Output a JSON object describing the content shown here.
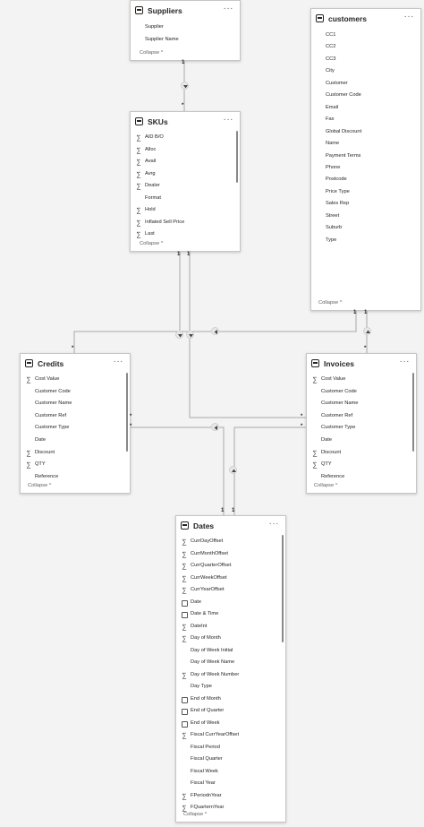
{
  "tables": [
    {
      "id": "suppliers",
      "name": "Suppliers",
      "more": "···",
      "collapse": "Collapse ^",
      "fields": [
        {
          "label": "Supplier",
          "icon": "none"
        },
        {
          "label": "Supplier Name",
          "icon": "none"
        }
      ]
    },
    {
      "id": "customers",
      "name": "customers",
      "more": "···",
      "collapse": "Collapse ^",
      "fields": [
        {
          "label": "CC1",
          "icon": "none"
        },
        {
          "label": "CC2",
          "icon": "none"
        },
        {
          "label": "CC3",
          "icon": "none"
        },
        {
          "label": "City",
          "icon": "none"
        },
        {
          "label": "Customer",
          "icon": "none"
        },
        {
          "label": "Customer Code",
          "icon": "none"
        },
        {
          "label": "Email",
          "icon": "none"
        },
        {
          "label": "Fax",
          "icon": "none"
        },
        {
          "label": "Global Discount",
          "icon": "none"
        },
        {
          "label": "Name",
          "icon": "none"
        },
        {
          "label": "Payment Terms",
          "icon": "none"
        },
        {
          "label": "Phone",
          "icon": "none"
        },
        {
          "label": "Postcode",
          "icon": "none"
        },
        {
          "label": "Price Type",
          "icon": "none"
        },
        {
          "label": "Sales Rep",
          "icon": "none"
        },
        {
          "label": "Street",
          "icon": "none"
        },
        {
          "label": "Suburb",
          "icon": "none"
        },
        {
          "label": "Type",
          "icon": "none"
        }
      ]
    },
    {
      "id": "skus",
      "name": "SKUs",
      "more": "···",
      "collapse": "Collapse ^",
      "fields": [
        {
          "label": "AID B/O",
          "icon": "sigma"
        },
        {
          "label": "Alloc",
          "icon": "sigma"
        },
        {
          "label": "Avail",
          "icon": "sigma"
        },
        {
          "label": "Avrg",
          "icon": "sigma"
        },
        {
          "label": "Dealer",
          "icon": "sigma"
        },
        {
          "label": "Format",
          "icon": "none"
        },
        {
          "label": "Hold",
          "icon": "sigma"
        },
        {
          "label": "Inflated Sell Price",
          "icon": "sigma"
        },
        {
          "label": "Last",
          "icon": "sigma"
        }
      ]
    },
    {
      "id": "credits",
      "name": "Credits",
      "more": "···",
      "collapse": "Collapse ^",
      "fields": [
        {
          "label": "Cost Value",
          "icon": "sigma"
        },
        {
          "label": "Customer Code",
          "icon": "none"
        },
        {
          "label": "Customer Name",
          "icon": "none"
        },
        {
          "label": "Customer Ref",
          "icon": "none"
        },
        {
          "label": "Customer Type",
          "icon": "none"
        },
        {
          "label": "Date",
          "icon": "none"
        },
        {
          "label": "Discount",
          "icon": "sigma"
        },
        {
          "label": "QTY",
          "icon": "sigma"
        },
        {
          "label": "Reference",
          "icon": "none"
        }
      ]
    },
    {
      "id": "invoices",
      "name": "Invoices",
      "more": "···",
      "collapse": "Collapse ^",
      "fields": [
        {
          "label": "Cost Value",
          "icon": "sigma"
        },
        {
          "label": "Customer Code",
          "icon": "none"
        },
        {
          "label": "Customer Name",
          "icon": "none"
        },
        {
          "label": "Customer Ref",
          "icon": "none"
        },
        {
          "label": "Customer Type",
          "icon": "none"
        },
        {
          "label": "Date",
          "icon": "none"
        },
        {
          "label": "Discount",
          "icon": "sigma"
        },
        {
          "label": "QTY",
          "icon": "sigma"
        },
        {
          "label": "Reference",
          "icon": "none"
        }
      ]
    },
    {
      "id": "dates",
      "name": "Dates",
      "more": "···",
      "collapse": "Collapse ^",
      "fields": [
        {
          "label": "CurrDayOffset",
          "icon": "sigma"
        },
        {
          "label": "CurrMonthOffset",
          "icon": "sigma"
        },
        {
          "label": "CurrQuarterOffset",
          "icon": "sigma"
        },
        {
          "label": "CurrWeekOffset",
          "icon": "sigma"
        },
        {
          "label": "CurrYearOffset",
          "icon": "sigma"
        },
        {
          "label": "Date",
          "icon": "calendar"
        },
        {
          "label": "Date & Time",
          "icon": "calendar"
        },
        {
          "label": "DateInt",
          "icon": "sigma"
        },
        {
          "label": "Day of Month",
          "icon": "sigma"
        },
        {
          "label": "Day of Week Initial",
          "icon": "none"
        },
        {
          "label": "Day of Week Name",
          "icon": "none"
        },
        {
          "label": "Day of Week Number",
          "icon": "sigma"
        },
        {
          "label": "Day Type",
          "icon": "none"
        },
        {
          "label": "End of Month",
          "icon": "calendar"
        },
        {
          "label": "End of Quarter",
          "icon": "calendar"
        },
        {
          "label": "End of Week",
          "icon": "calendar"
        },
        {
          "label": "Fiscal CurrYearOffset",
          "icon": "sigma"
        },
        {
          "label": "Fiscal Period",
          "icon": "none"
        },
        {
          "label": "Fiscal Quarter",
          "icon": "none"
        },
        {
          "label": "Fiscal Week",
          "icon": "none"
        },
        {
          "label": "Fiscal Year",
          "icon": "none"
        },
        {
          "label": "FPeriodnYear",
          "icon": "sigma"
        },
        {
          "label": "FQuarternYear",
          "icon": "sigma"
        }
      ]
    }
  ],
  "cardinality": {
    "one": "1",
    "many": "*"
  }
}
